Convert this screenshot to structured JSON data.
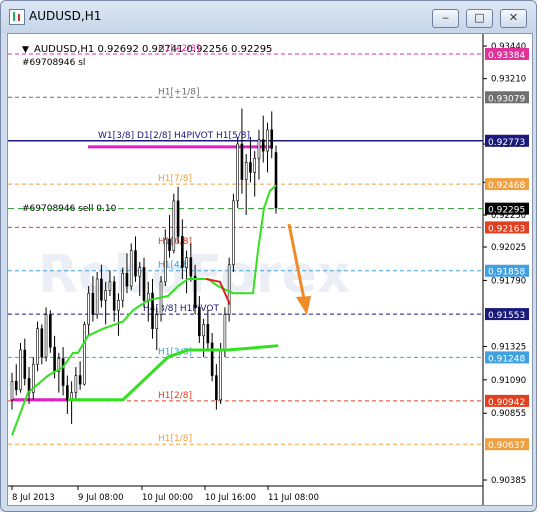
{
  "window": {
    "title": "AUDUSD,H1",
    "minimize_glyph": "‒",
    "maximize_glyph": "□",
    "close_glyph": "✕"
  },
  "chart": {
    "info_line": "AUDUSD,H1  0.92692 0.92741 0.92256 0.92295",
    "menu_glyph": "▼",
    "order_sl_label": "#69708946 sl",
    "order_label": "#69708946 sell 0.10",
    "watermark": "RoboForex",
    "current_price": "0.92295",
    "arrow_color": "#f08c28"
  },
  "chart_data": {
    "type": "candlestick",
    "symbol": "AUDUSD",
    "timeframe": "H1",
    "ohlc": {
      "open": 0.92692,
      "high": 0.92741,
      "low": 0.92256,
      "close": 0.92295
    },
    "ylim": [
      0.90385,
      0.9344
    ],
    "y_ticks": [
      "0.93440",
      "0.93210",
      "0.92750",
      "0.92480",
      "0.92250",
      "0.92025",
      "0.91790",
      "0.91325",
      "0.91090",
      "0.90855",
      "0.90385"
    ],
    "x_ticks": [
      "8 Jul 2013",
      "9 Jul 08:00",
      "10 Jul 00:00",
      "10 Jul 16:00",
      "11 Jul 08:00"
    ],
    "levels": [
      {
        "label": "H1[+2/8]",
        "price": "0.93384",
        "color": "#e0309a"
      },
      {
        "label": "H1[+1/8]",
        "price": "0.93079",
        "color": "#707070"
      },
      {
        "label": "W1[3/8] D1[2/8] H4PIVOT H1[5/8]",
        "price": "0.92773",
        "color": "#1a1a7a"
      },
      {
        "label": "H1[7/8]",
        "price": "0.92468",
        "color": "#f0a040"
      },
      {
        "label": "",
        "price": "0.92163",
        "color": "#e04020"
      },
      {
        "label": "H1[6/8]",
        "price": "",
        "color": "#e04020"
      },
      {
        "label": "H1[4/8]",
        "price": "0.91858",
        "color": "#40a0e0"
      },
      {
        "label": "H4[3/8] H1PIVOT",
        "price": "0.91553",
        "color": "#1a1a7a"
      },
      {
        "label": "H1[3/8]",
        "price": "0.91248",
        "color": "#40a0e0"
      },
      {
        "label": "H1[2/8]",
        "price": "0.90942",
        "color": "#e04020"
      },
      {
        "label": "H1[1/8]",
        "price": "0.90637",
        "color": "#f0a040"
      }
    ],
    "candles": [
      [
        0.9095,
        0.9114,
        0.9088,
        0.9108
      ],
      [
        0.9108,
        0.912,
        0.9098,
        0.9102
      ],
      [
        0.9102,
        0.9135,
        0.91,
        0.913
      ],
      [
        0.913,
        0.9138,
        0.9105,
        0.911
      ],
      [
        0.911,
        0.9118,
        0.9092,
        0.91
      ],
      [
        0.91,
        0.9125,
        0.9095,
        0.912
      ],
      [
        0.912,
        0.915,
        0.9115,
        0.9145
      ],
      [
        0.9145,
        0.9148,
        0.912,
        0.9125
      ],
      [
        0.9125,
        0.916,
        0.9122,
        0.9155
      ],
      [
        0.9155,
        0.9158,
        0.9128,
        0.9132
      ],
      [
        0.9132,
        0.914,
        0.911,
        0.9115
      ],
      [
        0.9115,
        0.9128,
        0.91,
        0.9124
      ],
      [
        0.9124,
        0.9132,
        0.9098,
        0.9105
      ],
      [
        0.9105,
        0.9112,
        0.9085,
        0.9095
      ],
      [
        0.9095,
        0.9108,
        0.9078,
        0.91
      ],
      [
        0.91,
        0.9118,
        0.9095,
        0.9112
      ],
      [
        0.9112,
        0.9122,
        0.9102,
        0.9106
      ],
      [
        0.9106,
        0.915,
        0.9105,
        0.9148
      ],
      [
        0.9148,
        0.9175,
        0.914,
        0.917
      ],
      [
        0.917,
        0.9182,
        0.915,
        0.9155
      ],
      [
        0.9155,
        0.9185,
        0.9152,
        0.918
      ],
      [
        0.918,
        0.919,
        0.916,
        0.9165
      ],
      [
        0.9165,
        0.9178,
        0.9148,
        0.9172
      ],
      [
        0.9172,
        0.9186,
        0.9168,
        0.9178
      ],
      [
        0.9178,
        0.9182,
        0.915,
        0.9158
      ],
      [
        0.9158,
        0.917,
        0.914,
        0.9165
      ],
      [
        0.9165,
        0.9188,
        0.916,
        0.9184
      ],
      [
        0.9184,
        0.9198,
        0.917,
        0.9175
      ],
      [
        0.9175,
        0.9205,
        0.9172,
        0.92
      ],
      [
        0.92,
        0.921,
        0.9178,
        0.9182
      ],
      [
        0.9182,
        0.9192,
        0.9168,
        0.9188
      ],
      [
        0.9188,
        0.9195,
        0.916,
        0.9165
      ],
      [
        0.9165,
        0.9178,
        0.915,
        0.917
      ],
      [
        0.917,
        0.918,
        0.9138,
        0.9145
      ],
      [
        0.9145,
        0.916,
        0.913,
        0.9155
      ],
      [
        0.9155,
        0.9182,
        0.915,
        0.9178
      ],
      [
        0.9178,
        0.9215,
        0.9175,
        0.9208
      ],
      [
        0.9208,
        0.9225,
        0.9195,
        0.92
      ],
      [
        0.92,
        0.924,
        0.9198,
        0.9235
      ],
      [
        0.9235,
        0.9245,
        0.9205,
        0.921
      ],
      [
        0.921,
        0.9222,
        0.918,
        0.9188
      ],
      [
        0.9188,
        0.92,
        0.917,
        0.9195
      ],
      [
        0.9195,
        0.9205,
        0.9178,
        0.9182
      ],
      [
        0.9182,
        0.919,
        0.9155,
        0.916
      ],
      [
        0.916,
        0.9168,
        0.9135,
        0.914
      ],
      [
        0.914,
        0.9152,
        0.9125,
        0.9148
      ],
      [
        0.9148,
        0.9158,
        0.913,
        0.9135
      ],
      [
        0.9135,
        0.9142,
        0.9108,
        0.9112
      ],
      [
        0.9112,
        0.912,
        0.9088,
        0.9095
      ],
      [
        0.9095,
        0.9135,
        0.9092,
        0.913
      ],
      [
        0.913,
        0.916,
        0.9125,
        0.9155
      ],
      [
        0.9155,
        0.9195,
        0.915,
        0.919
      ],
      [
        0.919,
        0.924,
        0.9185,
        0.9235
      ],
      [
        0.9235,
        0.928,
        0.923,
        0.9275
      ],
      [
        0.9275,
        0.93,
        0.924,
        0.925
      ],
      [
        0.925,
        0.9268,
        0.9225,
        0.9262
      ],
      [
        0.9262,
        0.928,
        0.9248,
        0.9255
      ],
      [
        0.9255,
        0.927,
        0.9238,
        0.9265
      ],
      [
        0.9265,
        0.9285,
        0.925,
        0.9278
      ],
      [
        0.9278,
        0.9295,
        0.9262,
        0.927
      ],
      [
        0.927,
        0.929,
        0.9255,
        0.9285
      ],
      [
        0.9285,
        0.9298,
        0.9265,
        0.9272
      ],
      [
        0.9269,
        0.9274,
        0.9226,
        0.923
      ]
    ],
    "grid": false,
    "legend": "none"
  }
}
